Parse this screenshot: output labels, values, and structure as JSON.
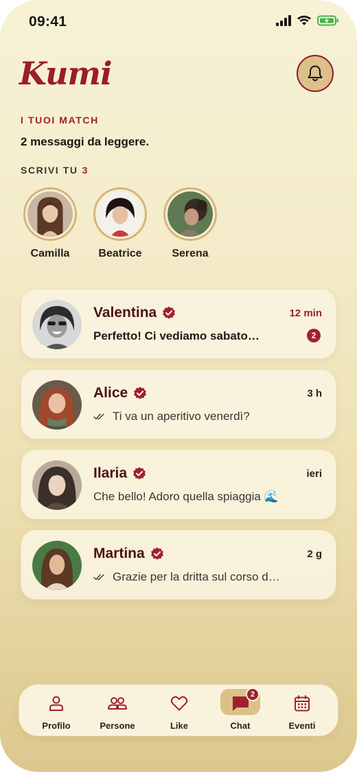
{
  "status_bar": {
    "time": "09:41"
  },
  "header": {
    "logo": "Kumi"
  },
  "matches": {
    "section_label": "I TUOI MATCH",
    "subtitle": "2 messaggi da leggere.",
    "write_label": "SCRIVI TU",
    "write_count": "3",
    "stories": [
      {
        "name": "Camilla"
      },
      {
        "name": "Beatrice"
      },
      {
        "name": "Serena"
      }
    ]
  },
  "chats": [
    {
      "name": "Valentina",
      "time": "12 min",
      "preview": "Perfetto! Ci vediamo sabato…",
      "unread": "2"
    },
    {
      "name": "Alice",
      "time": "3 h",
      "preview": "Ti va un aperitivo venerdì?"
    },
    {
      "name": "Ilaria",
      "time": "ieri",
      "preview": "Che bello! Adoro quella spiaggia 🌊"
    },
    {
      "name": "Martina",
      "time": "2 g",
      "preview": "Grazie per la dritta sul corso d…"
    }
  ],
  "tabbar": {
    "tabs": [
      {
        "label": "Profilo",
        "icon": "user-icon"
      },
      {
        "label": "Persone",
        "icon": "people-icon"
      },
      {
        "label": "Like",
        "icon": "heart-icon"
      },
      {
        "label": "Chat",
        "icon": "chat-icon",
        "badge": "2"
      },
      {
        "label": "Eventi",
        "icon": "calendar-icon"
      }
    ]
  },
  "colors": {
    "accent": "#a0202f",
    "gold": "#dcc089",
    "background": "#f4eccb"
  }
}
